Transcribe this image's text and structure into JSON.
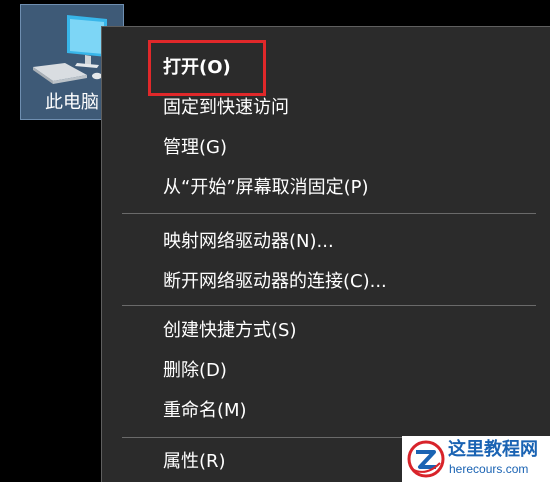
{
  "desktop_icon": {
    "label": "此电脑",
    "icon": "computer-icon"
  },
  "context_menu": {
    "groups": [
      [
        {
          "label": "打开(O)",
          "bold": true
        },
        {
          "label": "固定到快速访问"
        },
        {
          "label": "管理(G)"
        },
        {
          "label": "从“开始”屏幕取消固定(P)"
        }
      ],
      [
        {
          "label": "映射网络驱动器(N)..."
        },
        {
          "label": "断开网络驱动器的连接(C)..."
        }
      ],
      [
        {
          "label": "创建快捷方式(S)"
        },
        {
          "label": "删除(D)"
        },
        {
          "label": "重命名(M)"
        }
      ],
      [
        {
          "label": "属性(R)"
        }
      ]
    ]
  },
  "highlight_color": "#e0282a",
  "watermark": {
    "title": "这里教程网",
    "url": "herecours.com",
    "icon": "site-logo-icon"
  }
}
